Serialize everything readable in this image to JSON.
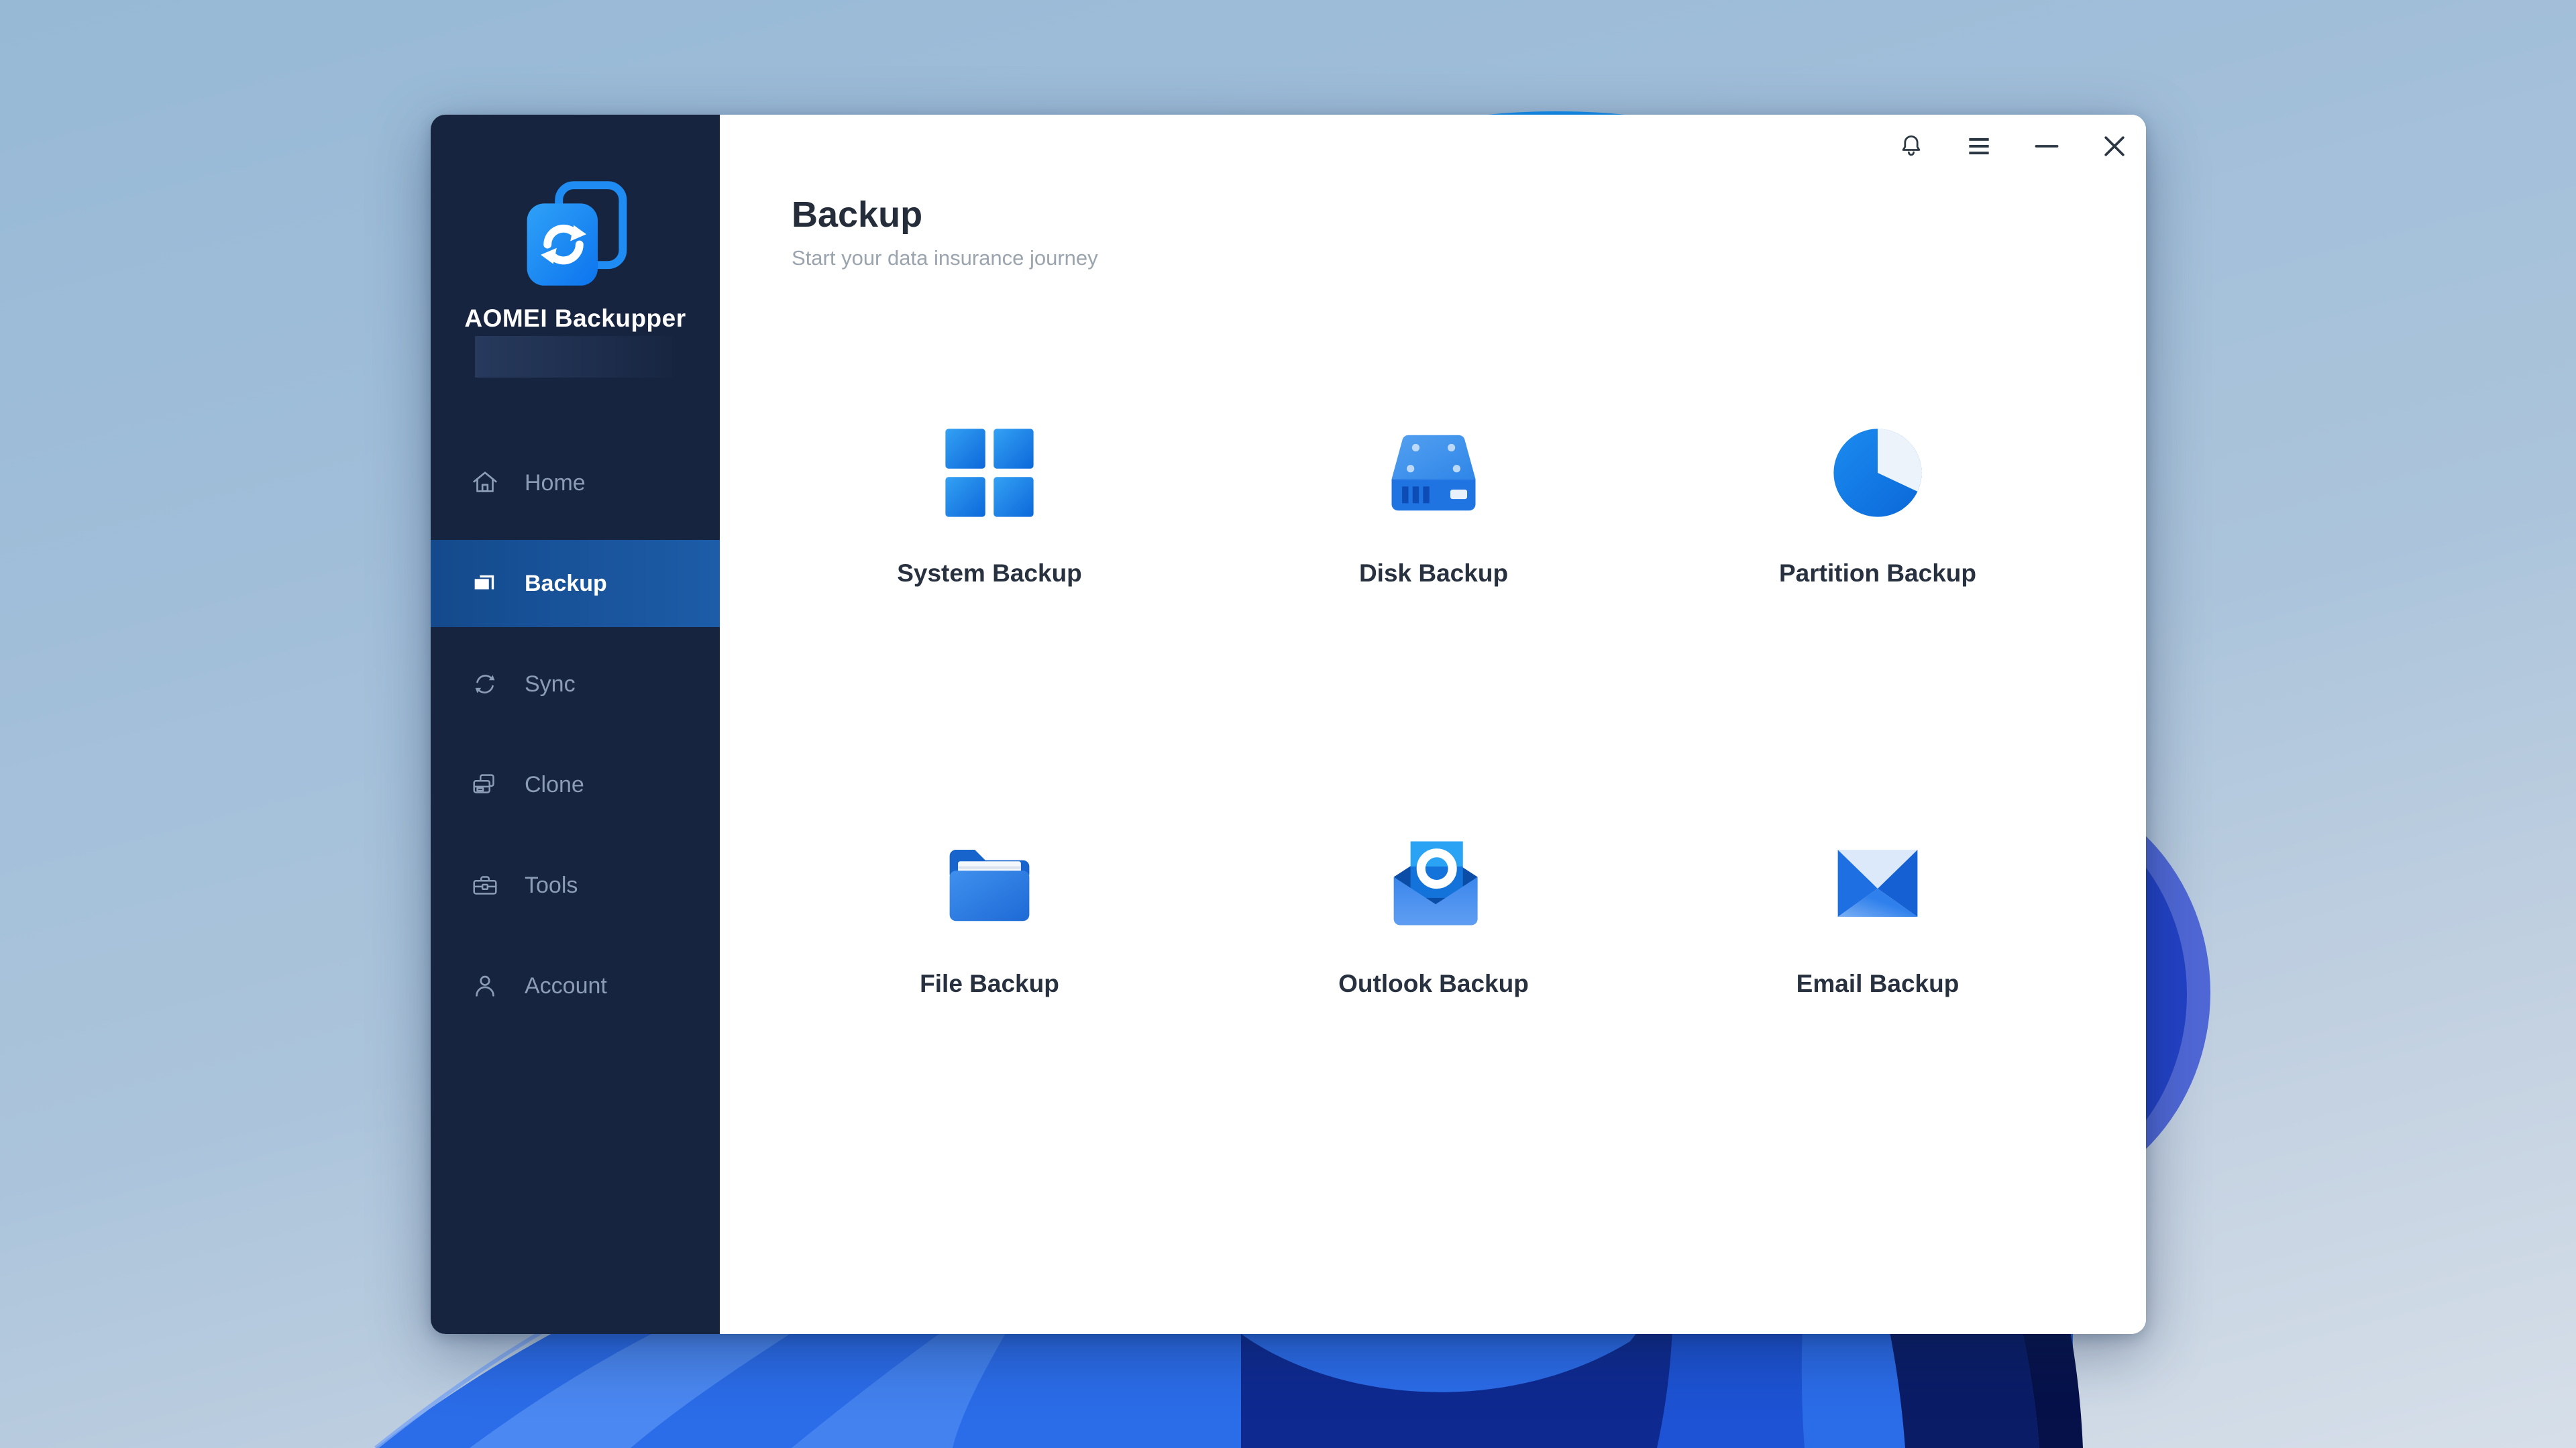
{
  "app": {
    "name": "AOMEI Backupper",
    "logo_icon": "sync-arrows-logo"
  },
  "titlebar": {
    "controls": [
      {
        "name": "notifications",
        "icon": "bell-icon"
      },
      {
        "name": "menu",
        "icon": "hamburger-menu-icon"
      },
      {
        "name": "minimize",
        "icon": "minimize-icon"
      },
      {
        "name": "close",
        "icon": "close-icon"
      }
    ]
  },
  "sidebar": {
    "items": [
      {
        "label": "Home",
        "icon": "home-icon",
        "active": false
      },
      {
        "label": "Backup",
        "icon": "backup-icon",
        "active": true
      },
      {
        "label": "Sync",
        "icon": "sync-icon",
        "active": false
      },
      {
        "label": "Clone",
        "icon": "clone-icon",
        "active": false
      },
      {
        "label": "Tools",
        "icon": "tools-icon",
        "active": false
      },
      {
        "label": "Account",
        "icon": "account-icon",
        "active": false
      }
    ]
  },
  "main": {
    "title": "Backup",
    "subtitle": "Start your data insurance journey",
    "items": [
      {
        "label": "System Backup",
        "icon": "system-backup-icon"
      },
      {
        "label": "Disk Backup",
        "icon": "disk-backup-icon"
      },
      {
        "label": "Partition Backup",
        "icon": "partition-backup-icon"
      },
      {
        "label": "File Backup",
        "icon": "file-backup-icon"
      },
      {
        "label": "Outlook Backup",
        "icon": "outlook-backup-icon"
      },
      {
        "label": "Email Backup",
        "icon": "email-backup-icon"
      }
    ]
  },
  "colors": {
    "sidebar_bg": "#16243f",
    "active_item_gradient": "#144a8c → #1d5ca8",
    "accent_blue": "#1e8cf2",
    "title_text": "#242d39",
    "subtitle_text": "#9aa4ae",
    "nav_text": "#8b9cb6",
    "wallpaper_sky": "#a3c0da",
    "bloom_blue": "#2057d8"
  }
}
